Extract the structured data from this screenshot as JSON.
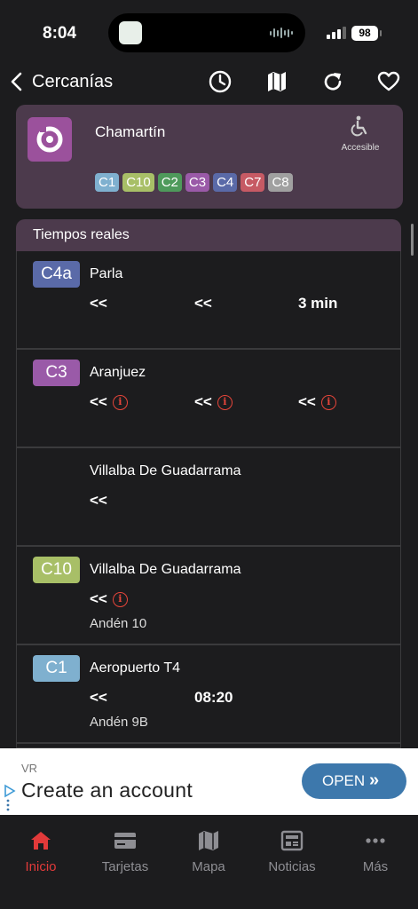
{
  "status_bar": {
    "time": "8:04",
    "battery": "98"
  },
  "header": {
    "back_label": "Cercanías"
  },
  "station": {
    "name": "Chamartín",
    "accessible_label": "Accesible",
    "lines": [
      {
        "label": "C1",
        "color": "#7fb0cf"
      },
      {
        "label": "C10",
        "color": "#a8bf67"
      },
      {
        "label": "C2",
        "color": "#4e9a5b"
      },
      {
        "label": "C3",
        "color": "#9a5aa8"
      },
      {
        "label": "C4",
        "color": "#5a6aa8"
      },
      {
        "label": "C7",
        "color": "#c65a64"
      },
      {
        "label": "C8",
        "color": "#a0a0a0"
      }
    ]
  },
  "realtime": {
    "title": "Tiempos reales",
    "rows": [
      {
        "line": "C4a",
        "color": "#5a6aa8",
        "destination": "Parla",
        "times": [
          "<<",
          "<<",
          "3 min"
        ],
        "warn": [
          false,
          false,
          false
        ],
        "platform": ""
      },
      {
        "line": "C3",
        "color": "#9a5aa8",
        "destination": "Aranjuez",
        "times": [
          "<<",
          "<<",
          "<<"
        ],
        "warn": [
          true,
          true,
          true
        ],
        "platform": ""
      },
      {
        "line": "",
        "color": "",
        "destination": "Villalba De Guadarrama",
        "times": [
          "<<",
          "",
          ""
        ],
        "warn": [
          false,
          false,
          false
        ],
        "platform": ""
      },
      {
        "line": "C10",
        "color": "#a8bf67",
        "destination": "Villalba De Guadarrama",
        "times": [
          "<<",
          "",
          ""
        ],
        "warn": [
          true,
          false,
          false
        ],
        "platform": "Andén 10"
      },
      {
        "line": "C1",
        "color": "#7fb0cf",
        "destination": "Aeropuerto T4",
        "times": [
          "<<",
          "08:20",
          ""
        ],
        "warn": [
          false,
          false,
          false
        ],
        "platform": "Andén 9B"
      }
    ]
  },
  "ad": {
    "sponsor": "VR",
    "headline": "Create an account",
    "cta": "OPEN",
    "cta_arrow": "»"
  },
  "tabs": [
    {
      "label": "Inicio",
      "icon": "home-icon",
      "active": true
    },
    {
      "label": "Tarjetas",
      "icon": "card-icon",
      "active": false
    },
    {
      "label": "Mapa",
      "icon": "map-icon",
      "active": false
    },
    {
      "label": "Noticias",
      "icon": "news-icon",
      "active": false
    },
    {
      "label": "Más",
      "icon": "more-icon",
      "active": false
    }
  ],
  "colors": {
    "accent": "#e23a3a",
    "card": "#4c3a4c",
    "station_icon": "#9b519c",
    "warning": "#e6453a",
    "ad_button": "#3d78ac"
  }
}
